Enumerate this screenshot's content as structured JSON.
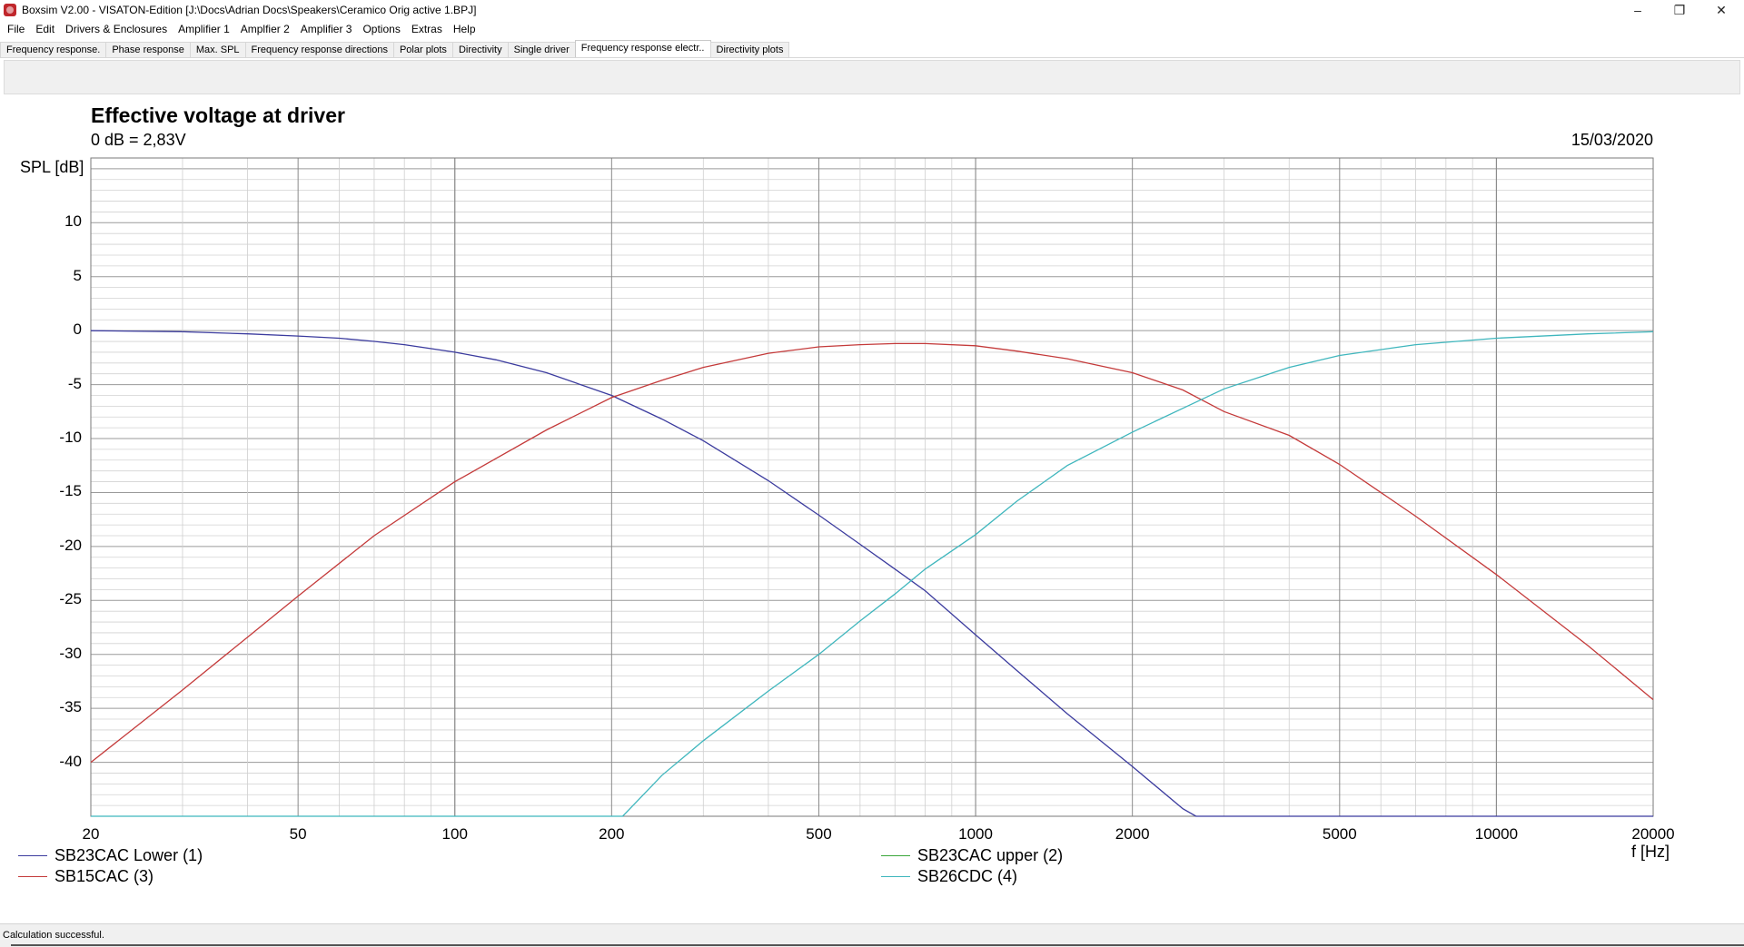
{
  "window": {
    "title": "Boxsim V2.00 - VISATON-Edition [J:\\Docs\\Adrian Docs\\Speakers\\Ceramico Orig active 1.BPJ]",
    "minimize": "–",
    "maximize": "❐",
    "close": "✕"
  },
  "menu": [
    "File",
    "Edit",
    "Drivers & Enclosures",
    "Amplifier 1",
    "Amplfier 2",
    "Amplifier 3",
    "Options",
    "Extras",
    "Help"
  ],
  "tabs": [
    {
      "label": "Frequency response.",
      "active": false
    },
    {
      "label": "Phase response",
      "active": false
    },
    {
      "label": "Max. SPL",
      "active": false
    },
    {
      "label": "Frequency response directions",
      "active": false
    },
    {
      "label": "Polar plots",
      "active": false
    },
    {
      "label": "Directivity",
      "active": false
    },
    {
      "label": "Single driver",
      "active": false
    },
    {
      "label": "Frequency response electr..",
      "active": true
    },
    {
      "label": "Directivity plots",
      "active": false
    }
  ],
  "status": {
    "text": "Calculation successful."
  },
  "chart_data": {
    "type": "line",
    "title": "Effective voltage at driver",
    "subtitle": "0 dB = 2,83V",
    "date": "15/03/2020",
    "ylabel": "SPL [dB]",
    "xlabel": "f [Hz]",
    "xscale": "log",
    "xlim": [
      20,
      20000
    ],
    "ylim": [
      -45,
      16
    ],
    "grid": true,
    "legend_placement": "bottom",
    "yticks": [
      10,
      5,
      0,
      -5,
      -10,
      -15,
      -20,
      -25,
      -30,
      -35,
      -40
    ],
    "xticks": [
      20,
      50,
      100,
      200,
      500,
      1000,
      2000,
      5000,
      10000,
      20000
    ],
    "series": [
      {
        "name": "SB23CAC Lower (1)",
        "color": "#3b3b9e",
        "x": [
          20,
          30,
          40,
          50,
          60,
          70,
          80,
          100,
          120,
          150,
          200,
          250,
          300,
          400,
          500,
          600,
          700,
          800,
          1000,
          1200,
          1500,
          2000,
          2500,
          2650,
          3000,
          5000,
          10000,
          20000
        ],
        "y": [
          0,
          -0.1,
          -0.3,
          -0.5,
          -0.7,
          -1.0,
          -1.3,
          -2.0,
          -2.7,
          -3.9,
          -6.0,
          -8.2,
          -10.2,
          -13.9,
          -17.1,
          -19.8,
          -22.1,
          -24.1,
          -28.2,
          -31.5,
          -35.5,
          -40.4,
          -44.3,
          -45,
          -45,
          -45,
          -45,
          -45
        ]
      },
      {
        "name": "SB23CAC upper (2)",
        "color": "#3aa63a",
        "x": [],
        "y": []
      },
      {
        "name": "SB15CAC (3)",
        "color": "#c43a3a",
        "x": [
          20,
          30,
          40,
          50,
          70,
          100,
          150,
          200,
          250,
          300,
          400,
          500,
          600,
          700,
          800,
          1000,
          1200,
          1500,
          2000,
          2500,
          3000,
          4000,
          5000,
          7000,
          10000,
          15000,
          20000
        ],
        "y": [
          -40,
          -33.3,
          -28.4,
          -24.6,
          -19.0,
          -14.0,
          -9.2,
          -6.2,
          -4.6,
          -3.4,
          -2.1,
          -1.5,
          -1.3,
          -1.2,
          -1.2,
          -1.4,
          -1.9,
          -2.6,
          -3.9,
          -5.5,
          -7.5,
          -9.7,
          -12.4,
          -17.2,
          -22.6,
          -29.2,
          -34.2
        ]
      },
      {
        "name": "SB26CDC (4)",
        "color": "#3fb6bd",
        "x": [
          20,
          100,
          200,
          210,
          250,
          300,
          400,
          500,
          600,
          700,
          800,
          1000,
          1200,
          1500,
          2000,
          2500,
          3000,
          4000,
          5000,
          7000,
          10000,
          15000,
          20000
        ],
        "y": [
          -45,
          -45,
          -45,
          -45,
          -41.2,
          -38.0,
          -33.4,
          -30.0,
          -26.9,
          -24.4,
          -22.1,
          -18.9,
          -15.8,
          -12.5,
          -9.4,
          -7.2,
          -5.4,
          -3.4,
          -2.3,
          -1.3,
          -0.7,
          -0.3,
          -0.1
        ]
      }
    ]
  }
}
